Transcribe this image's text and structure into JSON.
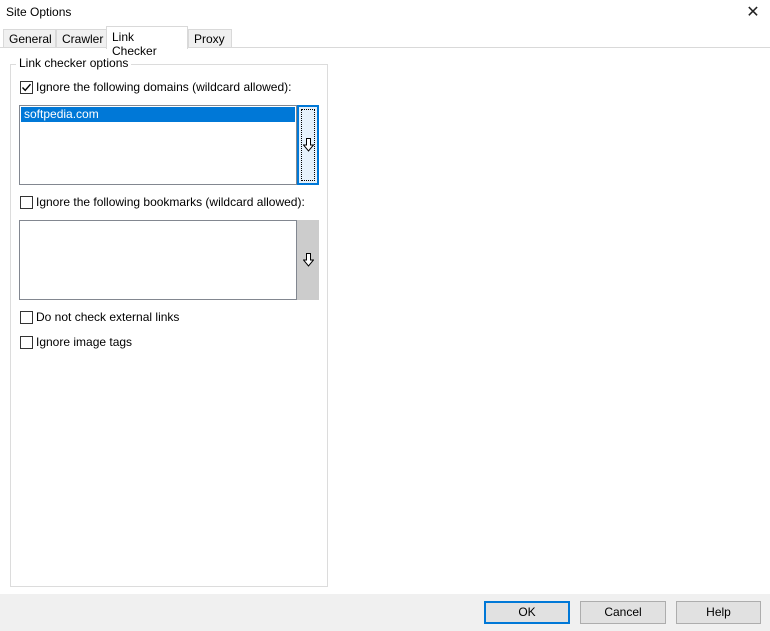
{
  "window": {
    "title": "Site Options",
    "close_glyph": "✕"
  },
  "tabs": [
    {
      "label": "General"
    },
    {
      "label": "Crawler"
    },
    {
      "label": "Link Checker",
      "active": true
    },
    {
      "label": "Proxy"
    }
  ],
  "link_checker": {
    "group_label": "Link checker options",
    "ignore_domains": {
      "label": "Ignore the following domains (wildcard allowed):",
      "checked": true,
      "items": [
        "softpedia.com"
      ],
      "selected_index": 0,
      "button_icon": "down-arrow-icon"
    },
    "ignore_bookmarks": {
      "label": "Ignore the following bookmarks (wildcard allowed):",
      "checked": false,
      "items": [],
      "button_icon": "down-arrow-icon"
    },
    "no_external": {
      "label": "Do not check external links",
      "checked": false
    },
    "ignore_images": {
      "label": "Ignore image tags",
      "checked": false
    }
  },
  "footer": {
    "ok_label": "OK",
    "cancel_label": "Cancel",
    "help_label": "Help"
  },
  "colors": {
    "selection": "#0078d7",
    "button_face": "#e1e1e1",
    "footer_bg": "#f0f0f0"
  }
}
